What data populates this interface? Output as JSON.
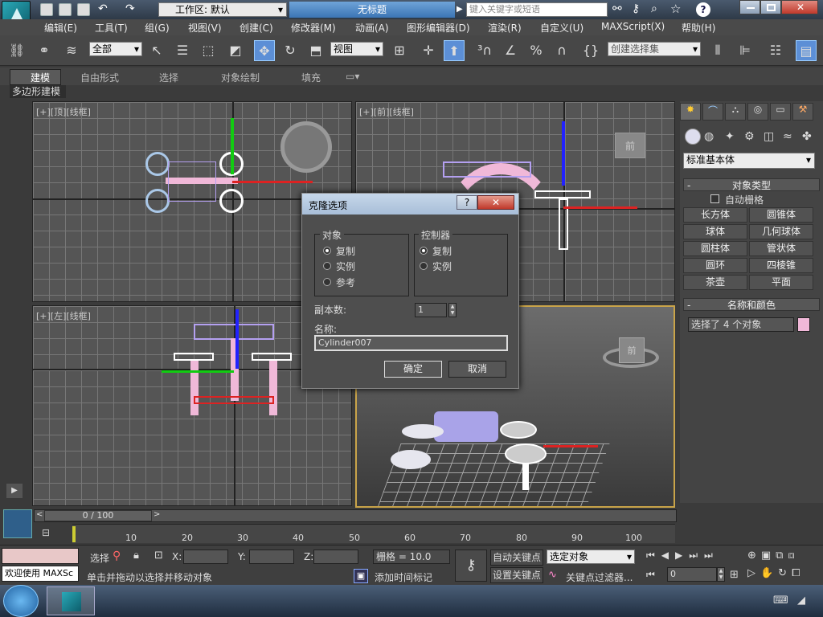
{
  "titlebar": {
    "workspace_label": "工作区: 默认",
    "doc_title": "无标题",
    "search_placeholder": "键入关键字或短语"
  },
  "menu": [
    "编辑(E)",
    "工具(T)",
    "组(G)",
    "视图(V)",
    "创建(C)",
    "修改器(M)",
    "动画(A)",
    "图形编辑器(D)",
    "渲染(R)",
    "自定义(U)",
    "MAXScript(X)",
    "帮助(H)"
  ],
  "toolbar": {
    "selection_filter": "全部",
    "ref_coord": "视图",
    "named_selection": "创建选择集"
  },
  "ribbon": {
    "tabs": [
      "建模",
      "自由形式",
      "选择",
      "对象绘制",
      "填充"
    ],
    "subtab": "多边形建模"
  },
  "viewports": {
    "top_label": "[+][顶][线框]",
    "front_label": "[+][前][线框]",
    "left_label": "[+][左][线框]",
    "cube_front": "前"
  },
  "command_panel": {
    "category": "标准基本体",
    "object_type_header": "对象类型",
    "autogrid": "自动栅格",
    "buttons": [
      "长方体",
      "圆锥体",
      "球体",
      "几何球体",
      "圆柱体",
      "管状体",
      "圆环",
      "四棱锥",
      "茶壶",
      "平面"
    ],
    "name_color_header": "名称和颜色",
    "name_value": "选择了 4 个对象",
    "color": "#f0b8d8"
  },
  "dialog": {
    "title": "克隆选项",
    "object_group": "对象",
    "object_options": [
      "复制",
      "实例",
      "参考"
    ],
    "object_selected": 0,
    "controller_group": "控制器",
    "controller_options": [
      "复制",
      "实例"
    ],
    "controller_selected": 0,
    "copies_label": "副本数:",
    "copies_value": "1",
    "name_label": "名称:",
    "name_value": "Cylinder007",
    "ok": "确定",
    "cancel": "取消"
  },
  "timeline": {
    "frame": "0 / 100",
    "ticks": [
      "10",
      "20",
      "30",
      "40",
      "50",
      "60",
      "70",
      "80",
      "90",
      "100"
    ]
  },
  "status": {
    "welcome": "欢迎使用 MAXSc",
    "select_label": "选择",
    "x_label": "X:",
    "y_label": "Y:",
    "z_label": "Z:",
    "grid": "栅格 = 10.0",
    "auto_key": "自动关键点",
    "set_key": "设置关键点",
    "key_mode": "选定对象",
    "key_filter": "关键点过滤器...",
    "frame_field": "0",
    "prompt": "单击并拖动以选择并移动对象",
    "add_time_tag": "添加时间标记"
  }
}
